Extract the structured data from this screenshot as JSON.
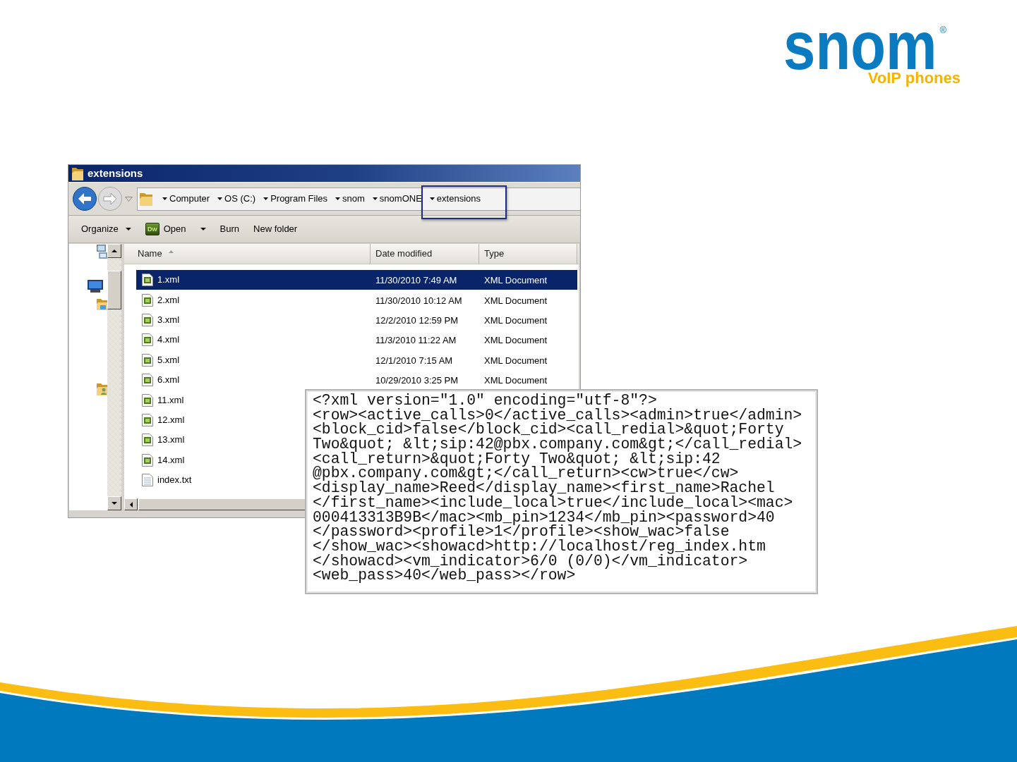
{
  "logo": {
    "wordmark": "snom",
    "registered": "®",
    "tagline": "VoIP phones"
  },
  "explorer": {
    "title": "extensions",
    "navigation": {
      "back_disabled": false,
      "forward_disabled": true
    },
    "breadcrumbs": [
      {
        "label": "Computer",
        "highlighted": false
      },
      {
        "label": "OS (C:)",
        "highlighted": false
      },
      {
        "label": "Program Files",
        "highlighted": false
      },
      {
        "label": "snom",
        "highlighted": false
      },
      {
        "label": "snomONE",
        "highlighted": false
      },
      {
        "label": "extensions",
        "highlighted": true
      }
    ],
    "toolbar": [
      {
        "label": "Organize",
        "kind": "menu"
      },
      {
        "label": "Open",
        "kind": "split",
        "icon_text": "Dw"
      },
      {
        "label": "Burn",
        "kind": "plain"
      },
      {
        "label": "New folder",
        "kind": "plain"
      }
    ],
    "columns": [
      {
        "label": "Name",
        "sorted": true
      },
      {
        "label": "Date modified",
        "sorted": false
      },
      {
        "label": "Type",
        "sorted": false
      }
    ],
    "files": [
      {
        "name": "1.xml",
        "kind": "xml",
        "date_modified": "11/30/2010 7:49 AM",
        "type": "XML Document",
        "selected": true
      },
      {
        "name": "2.xml",
        "kind": "xml",
        "date_modified": "11/30/2010 10:12 AM",
        "type": "XML Document",
        "selected": false
      },
      {
        "name": "3.xml",
        "kind": "xml",
        "date_modified": "12/2/2010 12:59 PM",
        "type": "XML Document",
        "selected": false
      },
      {
        "name": "4.xml",
        "kind": "xml",
        "date_modified": "11/3/2010 11:22 AM",
        "type": "XML Document",
        "selected": false
      },
      {
        "name": "5.xml",
        "kind": "xml",
        "date_modified": "12/1/2010 7:15 AM",
        "type": "XML Document",
        "selected": false
      },
      {
        "name": "6.xml",
        "kind": "xml",
        "date_modified": "10/29/2010 3:25 PM",
        "type": "XML Document",
        "selected": false
      },
      {
        "name": "11.xml",
        "kind": "xml",
        "selected": false
      },
      {
        "name": "12.xml",
        "kind": "xml",
        "selected": false
      },
      {
        "name": "13.xml",
        "kind": "xml",
        "selected": false
      },
      {
        "name": "14.xml",
        "kind": "xml",
        "selected": false
      },
      {
        "name": "index.txt",
        "kind": "text",
        "selected": false
      }
    ]
  },
  "xml_popup": {
    "lines": [
      "<?xml version=\"1.0\" encoding=\"utf-8\"?>",
      "<row><active_calls>0</active_calls><admin>true</admin>",
      "<block_cid>false</block_cid><call_redial>&quot;Forty",
      "Two&quot; &lt;sip:42@pbx.company.com&gt;</call_redial>",
      "<call_return>&quot;Forty Two&quot; &lt;sip:42",
      "@pbx.company.com&gt;</call_return><cw>true</cw>",
      "<display_name>Reed</display_name><first_name>Rachel",
      "</first_name><include_local>true</include_local><mac>",
      "000413313B9B</mac><mb_pin>1234</mb_pin><password>40",
      "</password><profile>1</profile><show_wac>false",
      "</show_wac><showacd>http://localhost/reg_index.htm",
      "</showacd><vm_indicator>6/0 (0/0)</vm_indicator>",
      "<web_pass>40</web_pass></row>"
    ]
  }
}
